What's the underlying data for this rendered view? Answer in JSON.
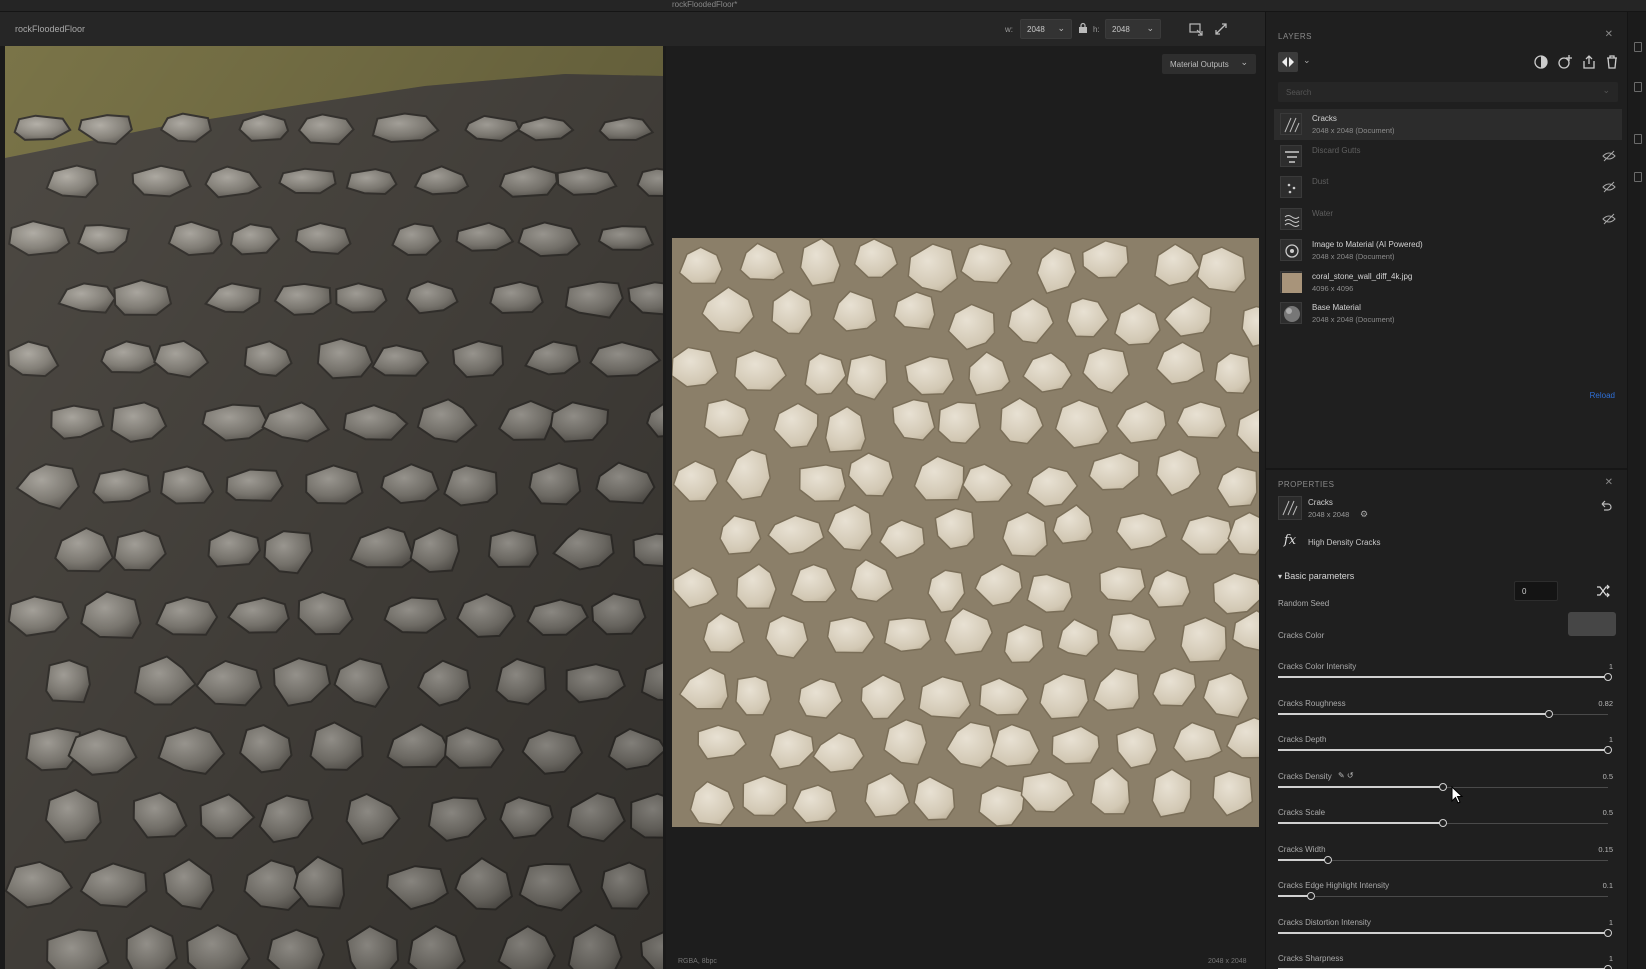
{
  "window": {
    "document_title": "rockFloodedFloor*"
  },
  "toolbar": {
    "doc_name": "rockFloodedFloor",
    "width_label": "w:",
    "width_value": "2048",
    "height_label": "h:",
    "height_value": "2048"
  },
  "view2d": {
    "material_outputs": "Material Outputs",
    "footer_left": "RGBA, 8bpc",
    "footer_right": "2048 x 2048"
  },
  "layers": {
    "header": "LAYERS",
    "search_placeholder": "Search",
    "reload": "Reload",
    "items": [
      {
        "name": "Cracks",
        "sub": "2048 x 2048 (Document)",
        "icon": "cracks-icon",
        "selected": true,
        "hidden": false
      },
      {
        "name": "Discard Gutts",
        "sub": "",
        "icon": "filter-icon",
        "selected": false,
        "hidden": true
      },
      {
        "name": "Dust",
        "sub": "",
        "icon": "dust-icon",
        "selected": false,
        "hidden": true
      },
      {
        "name": "Water",
        "sub": "",
        "icon": "water-icon",
        "selected": false,
        "hidden": true
      },
      {
        "name": "Image to Material (AI Powered)",
        "sub": "2048 x 2048 (Document)",
        "icon": "ai-material-icon",
        "selected": false,
        "hidden": false
      },
      {
        "name": "coral_stone_wall_diff_4k.jpg",
        "sub": "4096 x 4096",
        "icon": "image-icon",
        "selected": false,
        "hidden": false
      },
      {
        "name": "Base Material",
        "sub": "2048 x 2048 (Document)",
        "icon": "sphere-icon",
        "selected": false,
        "hidden": false
      }
    ]
  },
  "properties": {
    "header": "PROPERTIES",
    "item_name": "Cracks",
    "item_size": "2048 x 2048",
    "filter_name": "High Density Cracks",
    "section": "Basic parameters",
    "random_seed_label": "Random Seed",
    "random_seed_value": "0",
    "color_label": "Cracks Color",
    "color_value": "#464646",
    "params": [
      {
        "label": "Cracks Color Intensity",
        "value": "1",
        "fraction": 1.0
      },
      {
        "label": "Cracks Roughness",
        "value": "0.82",
        "fraction": 0.82
      },
      {
        "label": "Cracks Depth",
        "value": "1",
        "fraction": 1.0
      },
      {
        "label": "Cracks Density",
        "value": "0.5",
        "fraction": 0.5
      },
      {
        "label": "Cracks Scale",
        "value": "0.5",
        "fraction": 0.5
      },
      {
        "label": "Cracks Width",
        "value": "0.15",
        "fraction": 0.15
      },
      {
        "label": "Cracks Edge Highlight Intensity",
        "value": "0.1",
        "fraction": 0.1
      },
      {
        "label": "Cracks Distortion Intensity",
        "value": "1",
        "fraction": 1.0
      },
      {
        "label": "Cracks Sharpness",
        "value": "1",
        "fraction": 1.0
      }
    ]
  },
  "colors": {
    "accent": "#2f6fd6",
    "panel_bg": "#1f1f1f",
    "viewport_bg": "#1d1d1d"
  }
}
